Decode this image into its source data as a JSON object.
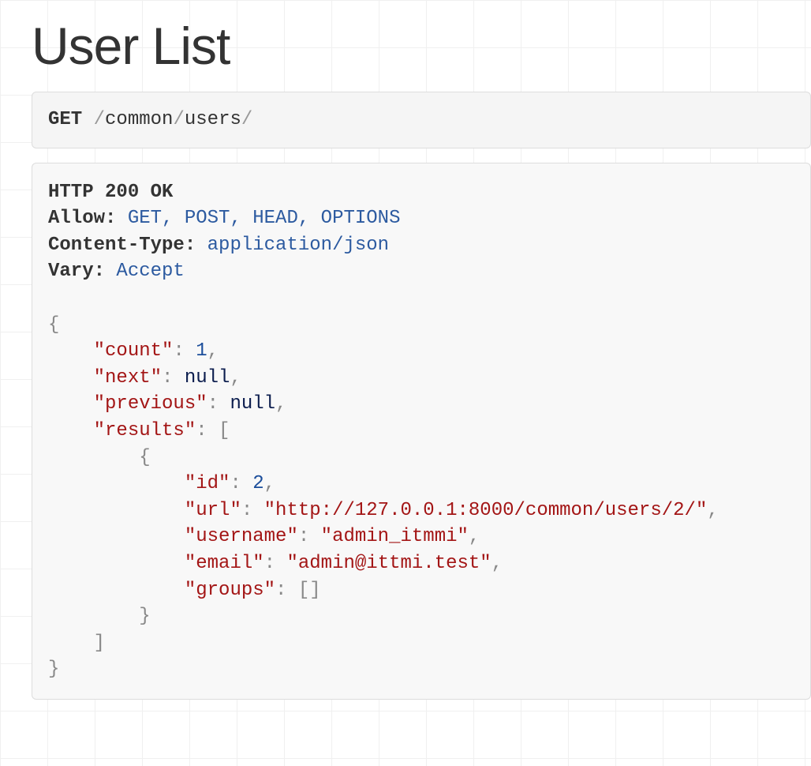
{
  "title": "User List",
  "request": {
    "method": "GET",
    "slash1": "/",
    "seg1": "common",
    "slash2": "/",
    "seg2": "users",
    "slash3": "/"
  },
  "response": {
    "status_line": "HTTP 200 OK",
    "allow_label": "Allow:",
    "allow_value": "GET, POST, HEAD, OPTIONS",
    "content_type_label": "Content-Type:",
    "content_type_value": "application/json",
    "vary_label": "Vary:",
    "vary_value": "Accept"
  },
  "json": {
    "open_brace": "{",
    "count_key": "\"count\"",
    "colon": ":",
    "count_val": "1",
    "comma": ",",
    "next_key": "\"next\"",
    "next_val": "null",
    "prev_key": "\"previous\"",
    "prev_val": "null",
    "results_key": "\"results\"",
    "open_bracket": "[",
    "inner_open_brace": "{",
    "id_key": "\"id\"",
    "id_val": "2",
    "url_key": "\"url\"",
    "url_val": "\"http://127.0.0.1:8000/common/users/2/\"",
    "username_key": "\"username\"",
    "username_val": "\"admin_itmmi\"",
    "email_key": "\"email\"",
    "email_val": "\"admin@ittmi.test\"",
    "groups_key": "\"groups\"",
    "groups_val_open": "[",
    "groups_val_close": "]",
    "inner_close_brace": "}",
    "close_bracket": "]",
    "close_brace": "}"
  }
}
